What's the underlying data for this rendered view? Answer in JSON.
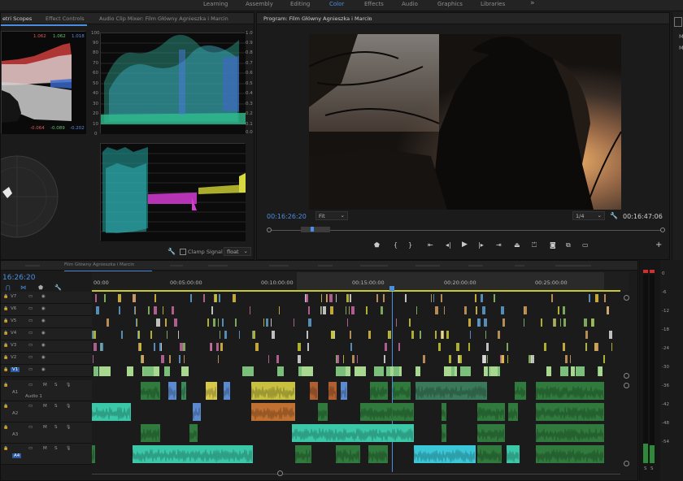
{
  "workspaces": [
    "Learning",
    "Assembly",
    "Editing",
    "Color",
    "Effects",
    "Audio",
    "Graphics",
    "Libraries"
  ],
  "workspace_active": "Color",
  "more_glyph": "»",
  "left_panel": {
    "tabs": [
      "etri Scopes",
      "Effect Controls",
      "Audio Clip Mixer: Film Główny Agnieszka i Marcin"
    ],
    "rgb_top": [
      "1.062",
      "1.062",
      "1.018"
    ],
    "rgb_bottom": [
      "-0.064",
      "-0.089",
      "-0.202"
    ],
    "scale_left": [
      "100",
      "90",
      "80",
      "70",
      "60",
      "50",
      "40",
      "30",
      "20",
      "10",
      "0"
    ],
    "scale_right": [
      "1.0",
      "0.9",
      "0.8",
      "0.7",
      "0.6",
      "0.5",
      "0.4",
      "0.3",
      "0.2",
      "0.1",
      "0.0"
    ],
    "clamp_label": "Clamp Signal",
    "float_label": "float"
  },
  "program": {
    "title": "Program: Film Główny Agnieszka i Marcin",
    "menu_glyph": "≡",
    "timecode_current": "00:16:26:20",
    "fit": "Fit",
    "resolution": "1/4",
    "timecode_duration": "00:16:47:06"
  },
  "right_edge_letters": [
    "M",
    "M",
    "",
    ""
  ],
  "timeline": {
    "timecode": "16:26:20",
    "tab_title": "Film Główny Agnieszka i Marcin",
    "ruler": [
      "00:00",
      "00:05:00:00",
      "00:10:00:00",
      "00:15:00:00",
      "00:20:00:00",
      "00:25:00:00"
    ],
    "video_tracks": [
      "V7",
      "V6",
      "V5",
      "V4",
      "V3",
      "V2",
      "V1"
    ],
    "audio_tracks": [
      "A1",
      "A2",
      "A3",
      "A4"
    ],
    "audio_sub": "Audio 1",
    "mute": "M",
    "solo": "S"
  },
  "meter": {
    "scale": [
      "0",
      "-6",
      "-12",
      "-18",
      "-24",
      "-30",
      "-36",
      "-42",
      "-48",
      "-54"
    ],
    "bottom": [
      "S",
      "S"
    ]
  },
  "colors": {
    "accent": "#4a8fe0",
    "timecode": "#4a8fe0",
    "v1_highlight": "#2a5aa0"
  }
}
